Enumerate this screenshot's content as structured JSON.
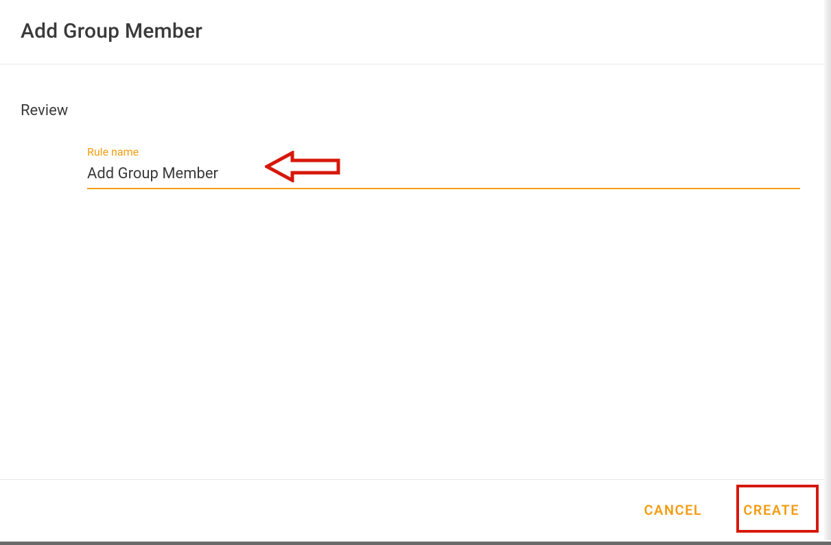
{
  "dialog": {
    "title": "Add Group Member"
  },
  "review": {
    "section_title": "Review",
    "rule_name_label": "Rule name",
    "rule_name_value": "Add Group Member"
  },
  "footer": {
    "cancel_label": "CANCEL",
    "create_label": "CREATE"
  },
  "colors": {
    "accent": "#f39c12",
    "annotation": "#d6180b"
  }
}
